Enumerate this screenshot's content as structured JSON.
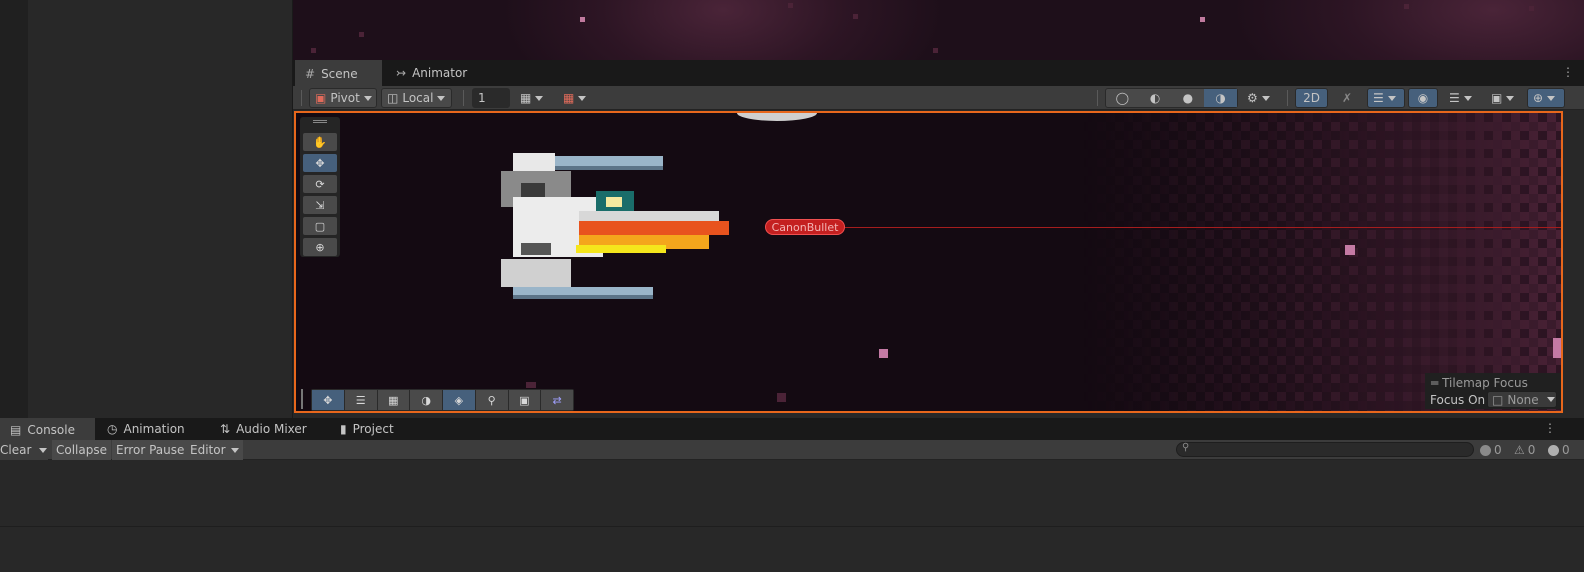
{
  "scene_tabs": {
    "scene": "Scene",
    "animator": "Animator"
  },
  "scene_toolbar": {
    "pivot": "Pivot",
    "local": "Local",
    "grid_snap_value": "1",
    "mode_2d": "2D"
  },
  "scene_view": {
    "bullet_label": "CanonBullet",
    "tilemap_focus": {
      "title": "Tilemap Focus",
      "label": "Focus On",
      "value": "None"
    }
  },
  "console_tabs": {
    "console": "Console",
    "animation": "Animation",
    "audio_mixer": "Audio Mixer",
    "project": "Project"
  },
  "console_toolbar": {
    "clear": "Clear",
    "collapse": "Collapse",
    "error_pause": "Error Pause",
    "editor": "Editor",
    "search_placeholder": ""
  },
  "console_counts": {
    "info": "0",
    "warnings": "0",
    "errors": "0"
  },
  "colors": {
    "selection_outline": "#e8671c",
    "bullet_label": "#c42020",
    "active_tool": "#46607c"
  }
}
